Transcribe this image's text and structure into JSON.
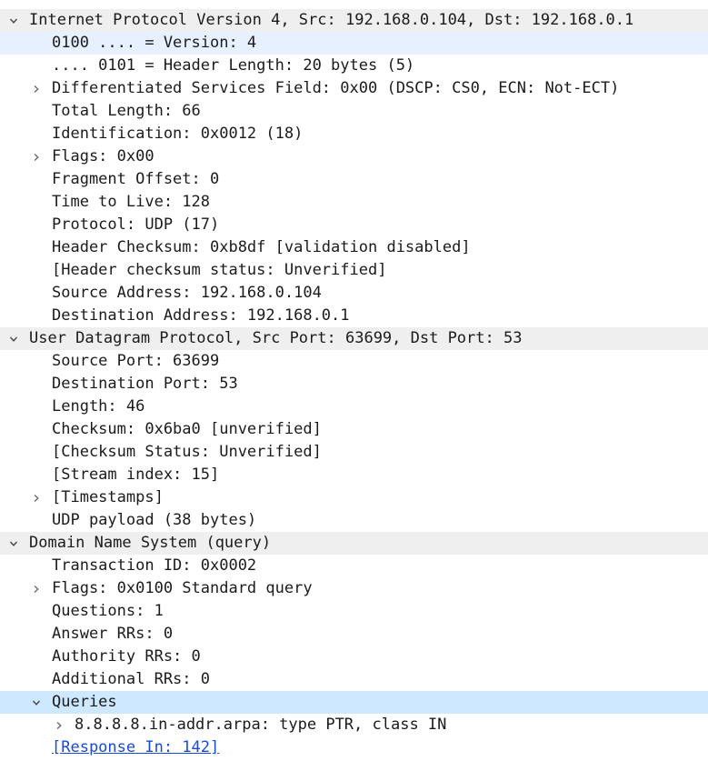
{
  "packet_details": {
    "ip": {
      "header": "Internet Protocol Version 4, Src: 192.168.0.104, Dst: 192.168.0.1",
      "fields": [
        "0100 .... = Version: 4",
        ".... 0101 = Header Length: 20 bytes (5)",
        "Differentiated Services Field: 0x00 (DSCP: CS0, ECN: Not-ECT)",
        "Total Length: 66",
        "Identification: 0x0012 (18)",
        "Flags: 0x00",
        "Fragment Offset: 0",
        "Time to Live: 128",
        "Protocol: UDP (17)",
        "Header Checksum: 0xb8df [validation disabled]",
        "[Header checksum status: Unverified]",
        "Source Address: 192.168.0.104",
        "Destination Address: 192.168.0.1"
      ]
    },
    "udp": {
      "header": "User Datagram Protocol, Src Port: 63699, Dst Port: 53",
      "fields": [
        "Source Port: 63699",
        "Destination Port: 53",
        "Length: 46",
        "Checksum: 0x6ba0 [unverified]",
        "[Checksum Status: Unverified]",
        "[Stream index: 15]",
        "[Timestamps]",
        "UDP payload (38 bytes)"
      ]
    },
    "dns": {
      "header": "Domain Name System (query)",
      "fields": [
        "Transaction ID: 0x0002",
        "Flags: 0x0100 Standard query",
        "Questions: 1",
        "Answer RRs: 0",
        "Authority RRs: 0",
        "Additional RRs: 0",
        "Queries",
        "8.8.8.8.in-addr.arpa: type PTR, class IN",
        "[Response In: 142]"
      ]
    }
  },
  "colors": {
    "section_background": "#efefef",
    "selected_background": "#e6f0ff",
    "highlight_background": "#cde8ff",
    "link": "#1a4ad6",
    "text": "#1b1b1b"
  }
}
